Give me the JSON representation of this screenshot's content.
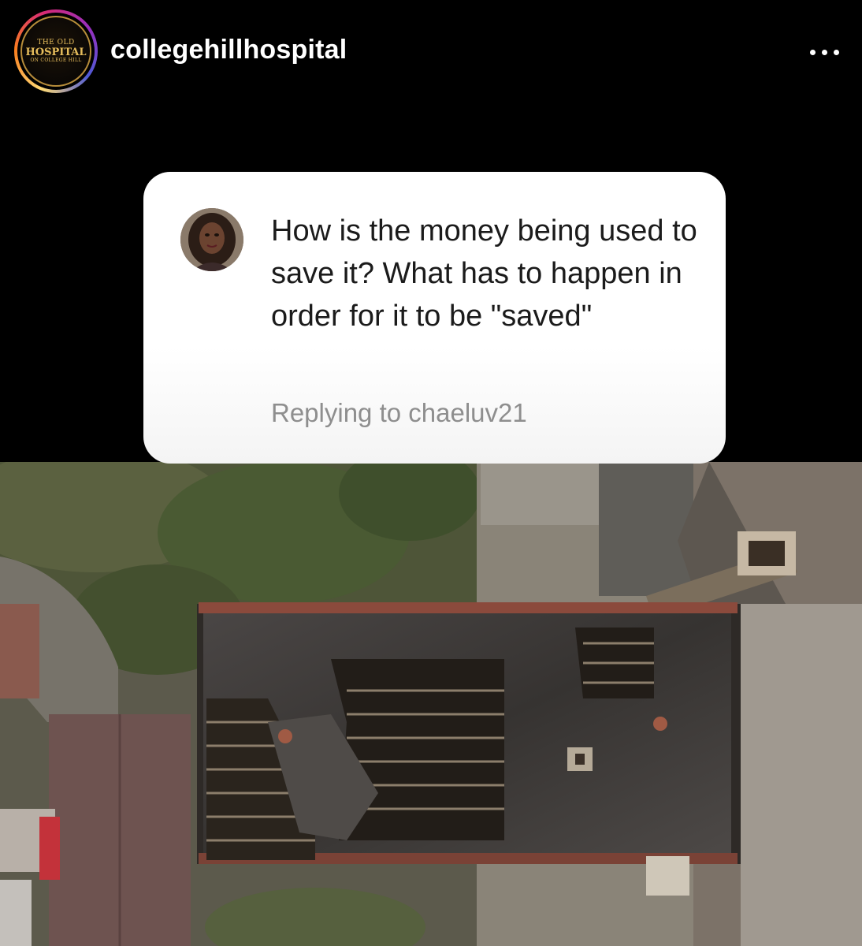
{
  "header": {
    "username": "collegehillhospital",
    "logo_text": {
      "line1": "THE OLD",
      "line2": "HOSPITAL",
      "line3": "ON COLLEGE HILL"
    },
    "more_icon": "more-horizontal-icon"
  },
  "question_card": {
    "question": "How is the money being used to save it? What has to happen in order for it to be \"saved\"",
    "reply_prefix": "Replying to",
    "reply_to": "chaeluv21"
  },
  "colors": {
    "background": "#000000",
    "card": "#ffffff",
    "question_text": "#1b1b1b",
    "reply_text": "#8e8e8e"
  }
}
